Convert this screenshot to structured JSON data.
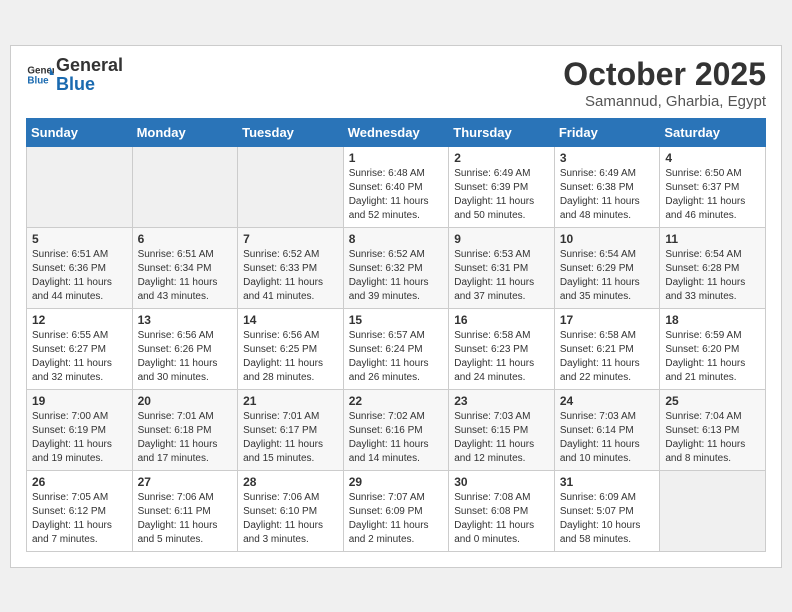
{
  "header": {
    "logo_general": "General",
    "logo_blue": "Blue",
    "month": "October 2025",
    "location": "Samannud, Gharbia, Egypt"
  },
  "weekdays": [
    "Sunday",
    "Monday",
    "Tuesday",
    "Wednesday",
    "Thursday",
    "Friday",
    "Saturday"
  ],
  "weeks": [
    [
      {
        "day": "",
        "info": ""
      },
      {
        "day": "",
        "info": ""
      },
      {
        "day": "",
        "info": ""
      },
      {
        "day": "1",
        "info": "Sunrise: 6:48 AM\nSunset: 6:40 PM\nDaylight: 11 hours\nand 52 minutes."
      },
      {
        "day": "2",
        "info": "Sunrise: 6:49 AM\nSunset: 6:39 PM\nDaylight: 11 hours\nand 50 minutes."
      },
      {
        "day": "3",
        "info": "Sunrise: 6:49 AM\nSunset: 6:38 PM\nDaylight: 11 hours\nand 48 minutes."
      },
      {
        "day": "4",
        "info": "Sunrise: 6:50 AM\nSunset: 6:37 PM\nDaylight: 11 hours\nand 46 minutes."
      }
    ],
    [
      {
        "day": "5",
        "info": "Sunrise: 6:51 AM\nSunset: 6:36 PM\nDaylight: 11 hours\nand 44 minutes."
      },
      {
        "day": "6",
        "info": "Sunrise: 6:51 AM\nSunset: 6:34 PM\nDaylight: 11 hours\nand 43 minutes."
      },
      {
        "day": "7",
        "info": "Sunrise: 6:52 AM\nSunset: 6:33 PM\nDaylight: 11 hours\nand 41 minutes."
      },
      {
        "day": "8",
        "info": "Sunrise: 6:52 AM\nSunset: 6:32 PM\nDaylight: 11 hours\nand 39 minutes."
      },
      {
        "day": "9",
        "info": "Sunrise: 6:53 AM\nSunset: 6:31 PM\nDaylight: 11 hours\nand 37 minutes."
      },
      {
        "day": "10",
        "info": "Sunrise: 6:54 AM\nSunset: 6:29 PM\nDaylight: 11 hours\nand 35 minutes."
      },
      {
        "day": "11",
        "info": "Sunrise: 6:54 AM\nSunset: 6:28 PM\nDaylight: 11 hours\nand 33 minutes."
      }
    ],
    [
      {
        "day": "12",
        "info": "Sunrise: 6:55 AM\nSunset: 6:27 PM\nDaylight: 11 hours\nand 32 minutes."
      },
      {
        "day": "13",
        "info": "Sunrise: 6:56 AM\nSunset: 6:26 PM\nDaylight: 11 hours\nand 30 minutes."
      },
      {
        "day": "14",
        "info": "Sunrise: 6:56 AM\nSunset: 6:25 PM\nDaylight: 11 hours\nand 28 minutes."
      },
      {
        "day": "15",
        "info": "Sunrise: 6:57 AM\nSunset: 6:24 PM\nDaylight: 11 hours\nand 26 minutes."
      },
      {
        "day": "16",
        "info": "Sunrise: 6:58 AM\nSunset: 6:23 PM\nDaylight: 11 hours\nand 24 minutes."
      },
      {
        "day": "17",
        "info": "Sunrise: 6:58 AM\nSunset: 6:21 PM\nDaylight: 11 hours\nand 22 minutes."
      },
      {
        "day": "18",
        "info": "Sunrise: 6:59 AM\nSunset: 6:20 PM\nDaylight: 11 hours\nand 21 minutes."
      }
    ],
    [
      {
        "day": "19",
        "info": "Sunrise: 7:00 AM\nSunset: 6:19 PM\nDaylight: 11 hours\nand 19 minutes."
      },
      {
        "day": "20",
        "info": "Sunrise: 7:01 AM\nSunset: 6:18 PM\nDaylight: 11 hours\nand 17 minutes."
      },
      {
        "day": "21",
        "info": "Sunrise: 7:01 AM\nSunset: 6:17 PM\nDaylight: 11 hours\nand 15 minutes."
      },
      {
        "day": "22",
        "info": "Sunrise: 7:02 AM\nSunset: 6:16 PM\nDaylight: 11 hours\nand 14 minutes."
      },
      {
        "day": "23",
        "info": "Sunrise: 7:03 AM\nSunset: 6:15 PM\nDaylight: 11 hours\nand 12 minutes."
      },
      {
        "day": "24",
        "info": "Sunrise: 7:03 AM\nSunset: 6:14 PM\nDaylight: 11 hours\nand 10 minutes."
      },
      {
        "day": "25",
        "info": "Sunrise: 7:04 AM\nSunset: 6:13 PM\nDaylight: 11 hours\nand 8 minutes."
      }
    ],
    [
      {
        "day": "26",
        "info": "Sunrise: 7:05 AM\nSunset: 6:12 PM\nDaylight: 11 hours\nand 7 minutes."
      },
      {
        "day": "27",
        "info": "Sunrise: 7:06 AM\nSunset: 6:11 PM\nDaylight: 11 hours\nand 5 minutes."
      },
      {
        "day": "28",
        "info": "Sunrise: 7:06 AM\nSunset: 6:10 PM\nDaylight: 11 hours\nand 3 minutes."
      },
      {
        "day": "29",
        "info": "Sunrise: 7:07 AM\nSunset: 6:09 PM\nDaylight: 11 hours\nand 2 minutes."
      },
      {
        "day": "30",
        "info": "Sunrise: 7:08 AM\nSunset: 6:08 PM\nDaylight: 11 hours\nand 0 minutes."
      },
      {
        "day": "31",
        "info": "Sunrise: 6:09 AM\nSunset: 5:07 PM\nDaylight: 10 hours\nand 58 minutes."
      },
      {
        "day": "",
        "info": ""
      }
    ]
  ]
}
